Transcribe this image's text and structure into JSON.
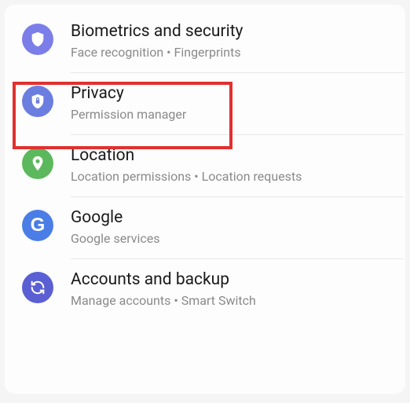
{
  "items": [
    {
      "id": "biometrics",
      "title": "Biometrics and security",
      "subtitle": "Face recognition  •  Fingerprints",
      "icon": "shield-icon",
      "icon_class": "icon-security"
    },
    {
      "id": "privacy",
      "title": "Privacy",
      "subtitle": "Permission manager",
      "icon": "privacy-shield-icon",
      "icon_class": "icon-privacy",
      "highlighted": true
    },
    {
      "id": "location",
      "title": "Location",
      "subtitle": "Location permissions  •  Location requests",
      "icon": "location-pin-icon",
      "icon_class": "icon-location"
    },
    {
      "id": "google",
      "title": "Google",
      "subtitle": "Google services",
      "icon": "google-g-icon",
      "icon_class": "icon-google"
    },
    {
      "id": "backup",
      "title": "Accounts and backup",
      "subtitle": "Manage accounts  •  Smart Switch",
      "icon": "sync-icon",
      "icon_class": "icon-backup"
    }
  ]
}
